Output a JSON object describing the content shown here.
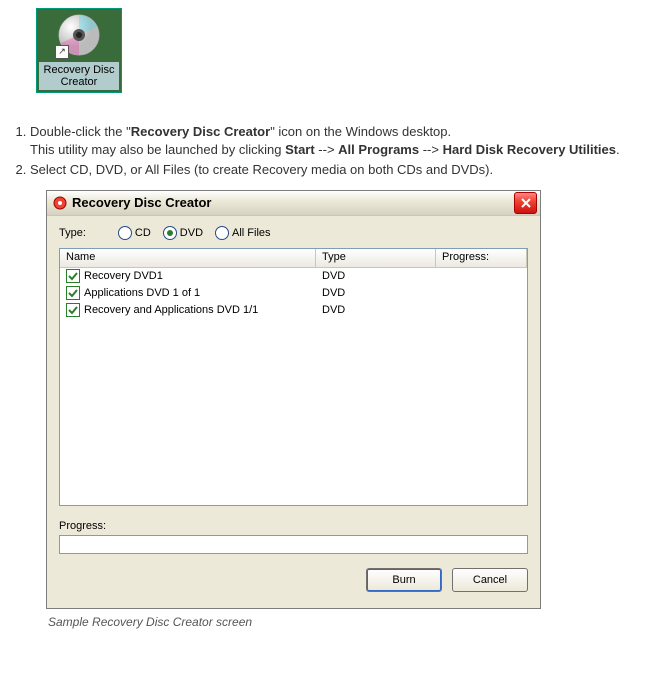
{
  "desktop_icon": {
    "label": "Recovery Disc Creator"
  },
  "steps": {
    "s1a": "Double-click the \"",
    "s1b": "Recovery Disc Creator",
    "s1c": "\" icon on the Windows desktop.",
    "s1sub_a": "This utility may also be launched by clicking ",
    "s1sub_b": "Start",
    "s1sub_c": " --> ",
    "s1sub_d": "All Programs",
    "s1sub_e": " --> ",
    "s1sub_f": "Hard Disk Recovery Utilities",
    "s1sub_g": ".",
    "s2": "Select CD, DVD, or All Files (to create Recovery media on both CDs and DVDs)."
  },
  "dialog": {
    "title": "Recovery Disc Creator",
    "type_label": "Type:",
    "radios": {
      "cd": "CD",
      "dvd": "DVD",
      "all": "All Files",
      "selected": "dvd"
    },
    "columns": {
      "name": "Name",
      "type": "Type",
      "progress": "Progress:"
    },
    "rows": [
      {
        "name": "Recovery DVD1",
        "type": "DVD",
        "checked": true
      },
      {
        "name": "Applications DVD 1 of 1",
        "type": "DVD",
        "checked": true
      },
      {
        "name": "Recovery and Applications DVD 1/1",
        "type": "DVD",
        "checked": true
      }
    ],
    "progress_label": "Progress:",
    "burn": "Burn",
    "cancel": "Cancel"
  },
  "caption": "Sample Recovery Disc Creator screen"
}
